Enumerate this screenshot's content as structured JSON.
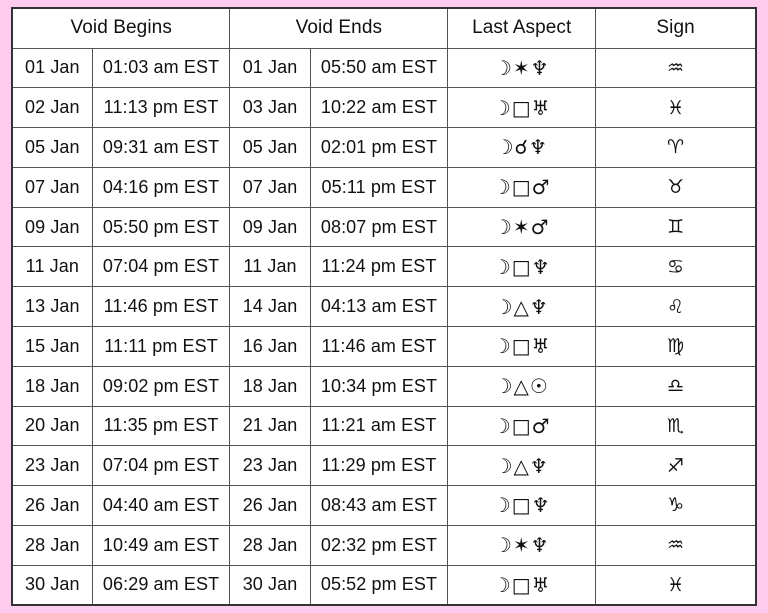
{
  "table": {
    "headers": [
      {
        "label": "Void Begins",
        "span": 2
      },
      {
        "label": "Void Ends",
        "span": 2
      },
      {
        "label": "Last Aspect",
        "span": 1
      },
      {
        "label": "Sign",
        "span": 1
      }
    ],
    "rows": [
      {
        "begin_date": "01 Jan",
        "begin_time": "01:03 am EST",
        "end_date": "01 Jan",
        "end_time": "05:50 am EST",
        "aspect": "☽✶♆",
        "sign": "♒"
      },
      {
        "begin_date": "02 Jan",
        "begin_time": "11:13 pm EST",
        "end_date": "03 Jan",
        "end_time": "10:22 am EST",
        "aspect": "☽□♅",
        "sign": "♓"
      },
      {
        "begin_date": "05 Jan",
        "begin_time": "09:31 am EST",
        "end_date": "05 Jan",
        "end_time": "02:01 pm EST",
        "aspect": "☽☌♆",
        "sign": "♈"
      },
      {
        "begin_date": "07 Jan",
        "begin_time": "04:16 pm EST",
        "end_date": "07 Jan",
        "end_time": "05:11 pm EST",
        "aspect": "☽□♂",
        "sign": "♉"
      },
      {
        "begin_date": "09 Jan",
        "begin_time": "05:50 pm EST",
        "end_date": "09 Jan",
        "end_time": "08:07 pm EST",
        "aspect": "☽✶♂",
        "sign": "♊"
      },
      {
        "begin_date": "11 Jan",
        "begin_time": "07:04 pm EST",
        "end_date": "11 Jan",
        "end_time": "11:24 pm EST",
        "aspect": "☽□♆",
        "sign": "♋"
      },
      {
        "begin_date": "13 Jan",
        "begin_time": "11:46 pm EST",
        "end_date": "14 Jan",
        "end_time": "04:13 am EST",
        "aspect": "☽△♆",
        "sign": "♌"
      },
      {
        "begin_date": "15 Jan",
        "begin_time": "11:11 pm EST",
        "end_date": "16 Jan",
        "end_time": "11:46 am EST",
        "aspect": "☽□♅",
        "sign": "♍"
      },
      {
        "begin_date": "18 Jan",
        "begin_time": "09:02 pm EST",
        "end_date": "18 Jan",
        "end_time": "10:34 pm EST",
        "aspect": "☽△☉",
        "sign": "♎"
      },
      {
        "begin_date": "20 Jan",
        "begin_time": "11:35 pm EST",
        "end_date": "21 Jan",
        "end_time": "11:21 am EST",
        "aspect": "☽□♂",
        "sign": "♏"
      },
      {
        "begin_date": "23 Jan",
        "begin_time": "07:04 pm EST",
        "end_date": "23 Jan",
        "end_time": "11:29 pm EST",
        "aspect": "☽△♆",
        "sign": "♐"
      },
      {
        "begin_date": "26 Jan",
        "begin_time": "04:40 am EST",
        "end_date": "26 Jan",
        "end_time": "08:43 am EST",
        "aspect": "☽□♆",
        "sign": "♑"
      },
      {
        "begin_date": "28 Jan",
        "begin_time": "10:49 am EST",
        "end_date": "28 Jan",
        "end_time": "02:32 pm EST",
        "aspect": "☽✶♆",
        "sign": "♒"
      },
      {
        "begin_date": "30 Jan",
        "begin_time": "06:29 am EST",
        "end_date": "30 Jan",
        "end_time": "05:52 pm EST",
        "aspect": "☽□♅",
        "sign": "♓"
      }
    ]
  },
  "colors": {
    "page_background": "#ffccee",
    "table_background": "#ffffff",
    "border": "#555555",
    "outer_border": "#333333",
    "text": "#111111"
  }
}
